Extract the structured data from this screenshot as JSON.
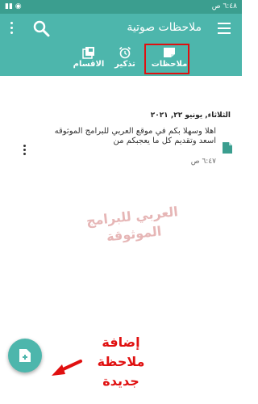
{
  "status_bar": {
    "time": "٦:٤٨ ص",
    "icons_right": ""
  },
  "app_bar": {
    "title": "ملاحظات صوتية",
    "tabs": [
      {
        "label": "ملاحظات",
        "icon": "note-icon",
        "selected": true
      },
      {
        "label": "تذكير",
        "icon": "alarm-icon"
      },
      {
        "label": "الاقسام",
        "icon": "sections-icon"
      }
    ]
  },
  "content": {
    "date_header": "الثلاثاء, يونيو ٢٢, ٢٠٢١",
    "note": {
      "text": "اهلا وسهلا بكم في موقع العربي للبرامج الموثوقه اسعد وتقديم كل ما يعجبكم من",
      "time": "٦:٤٧ ص"
    },
    "watermark": "العربي للبرامج الموثوقة"
  },
  "annotation": {
    "line1": "إضافة ملاحظة",
    "line2": "جديدة"
  },
  "colors": {
    "primary": "#4db6ac",
    "status": "#3b9e8f",
    "accent_red": "#e01010"
  }
}
